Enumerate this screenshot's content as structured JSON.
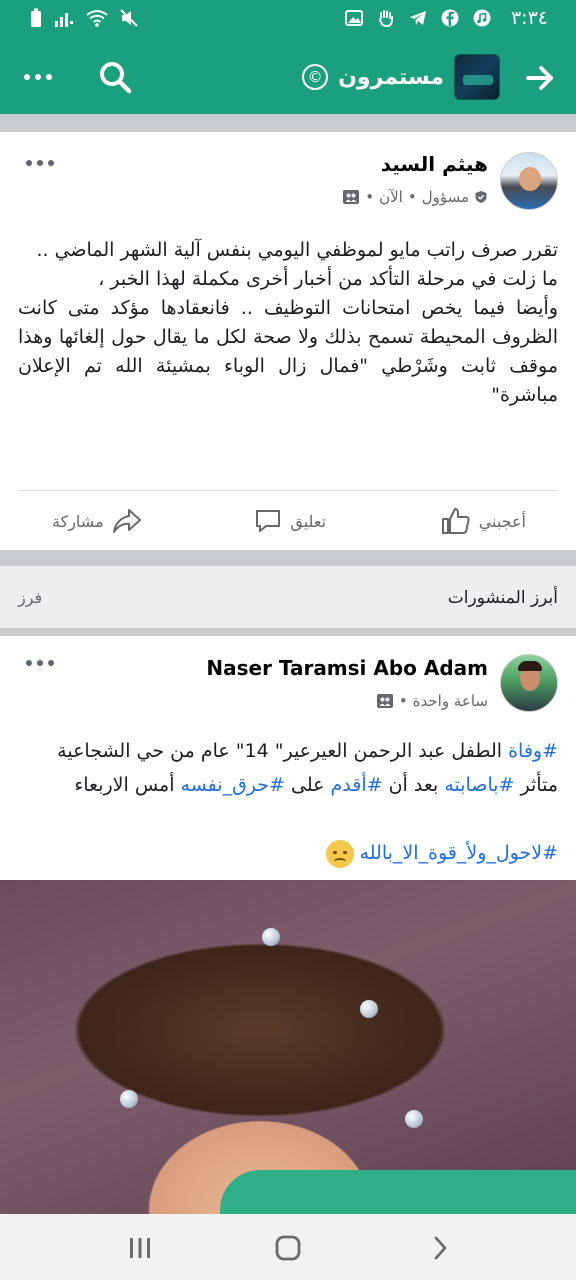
{
  "status_bar": {
    "time": "٣:٣٤"
  },
  "app_bar": {
    "page_name": "مستمرون",
    "badge": "©"
  },
  "post1": {
    "author": "هيثم السيد",
    "role": "مسؤول",
    "time": "الآن",
    "text_lines": [
      "تقرر صرف راتب مايو لموظفي اليومي بنفس آلية الشهر الماضي ..",
      "ما زلت في مرحلة التأكد من أخبار أخرى مكملة لهذا الخبر ،",
      "وأيضا فيما يخص امتحانات التوظيف .. فانعقادها مؤكد  متى كانت الظروف المحيطة تسمح بذلك ولا صحة لكل ما يقال حول إلغائها وهذا موقف ثابت وشَرْطي \"فمال زال الوباء بمشيئة الله تم الإعلان مباشرة\""
    ]
  },
  "actions": {
    "like": "أعجبني",
    "comment": "تعليق",
    "share": "مشاركة"
  },
  "section": {
    "title": "أبرز المنشورات",
    "sort": "فرز"
  },
  "post2": {
    "author": "Naser Taramsi Abo Adam",
    "time": "ساعة واحدة",
    "line1_tag1": "#وفاة",
    "line1_rest": " الطفل عبد الرحمن العيرعير\" 14\" عام من حي الشجاعية",
    "line2_a": "متأثر ",
    "line2_tag1": "#باصابته",
    "line2_b": " بعد أن ",
    "line2_tag2": "#أقدم",
    "line2_c": " على ",
    "line2_tag3": "#حرق_نفسه",
    "line2_d": " أمس الاربعاء",
    "line3_tag": "#لاحول_ولأ_قوة_الا_بالله"
  }
}
